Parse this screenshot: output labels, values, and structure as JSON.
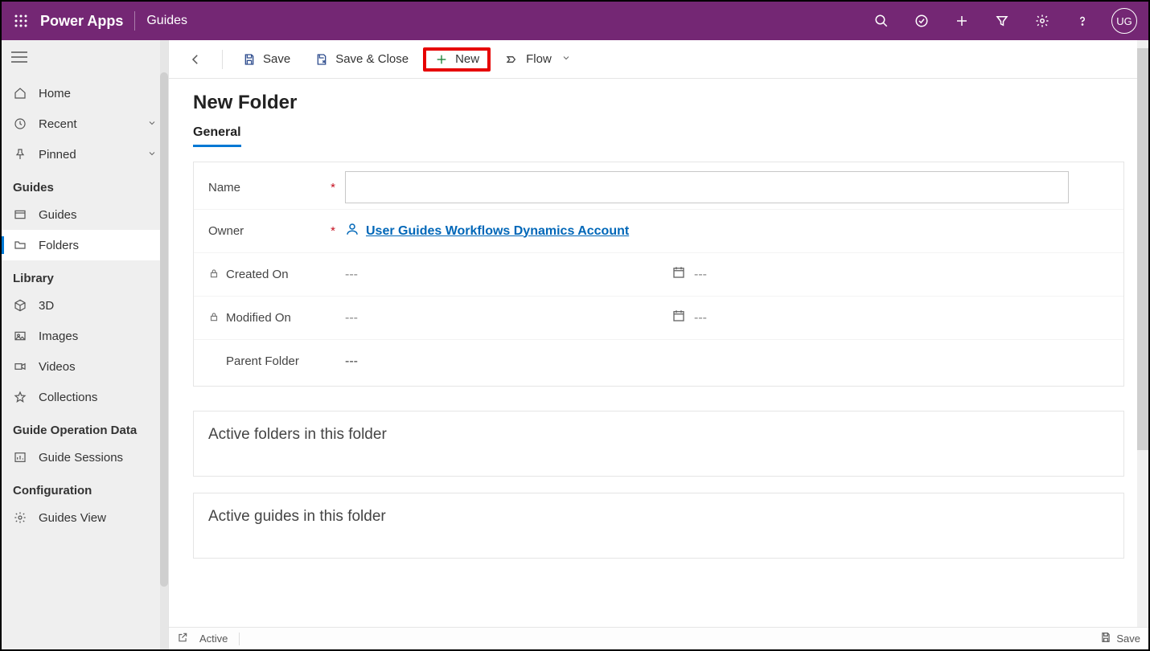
{
  "header": {
    "brand": "Power Apps",
    "app_name": "Guides",
    "avatar_initials": "UG"
  },
  "sidebar": {
    "home": "Home",
    "recent": "Recent",
    "pinned": "Pinned",
    "sections": {
      "guides": {
        "title": "Guides",
        "items": [
          "Guides",
          "Folders"
        ]
      },
      "library": {
        "title": "Library",
        "items": [
          "3D",
          "Images",
          "Videos",
          "Collections"
        ]
      },
      "gop": {
        "title": "Guide Operation Data",
        "items": [
          "Guide Sessions"
        ]
      },
      "config": {
        "title": "Configuration",
        "items": [
          "Guides View"
        ]
      }
    }
  },
  "cmdbar": {
    "save": "Save",
    "save_close": "Save & Close",
    "new": "New",
    "flow": "Flow"
  },
  "page": {
    "title": "New Folder",
    "tab_general": "General",
    "fields": {
      "name_label": "Name",
      "owner_label": "Owner",
      "owner_value": "User Guides Workflows Dynamics Account",
      "created_label": "Created On",
      "modified_label": "Modified On",
      "parent_label": "Parent Folder",
      "empty": "---"
    },
    "sub1": "Active folders in this folder",
    "sub2": "Active guides in this folder"
  },
  "statusbar": {
    "status": "Active",
    "save": "Save"
  }
}
